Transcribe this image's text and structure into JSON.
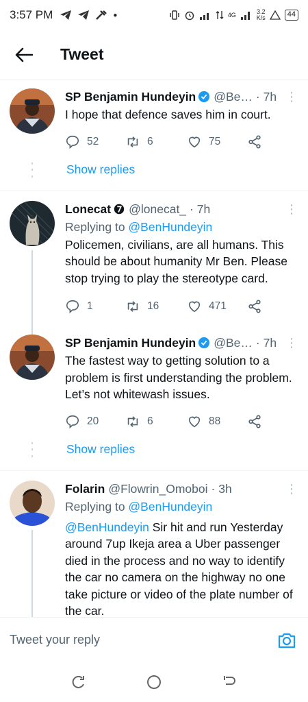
{
  "status_bar": {
    "time": "3:57 PM",
    "network": "4G",
    "speed": "3.2",
    "speed_unit": "K/s",
    "battery": "44"
  },
  "header": {
    "title": "Tweet"
  },
  "tweets": [
    {
      "name": "SP Benjamin Hundeyin",
      "verified": true,
      "handle": "@Be…",
      "time": "· 7h",
      "text": "I hope that defence saves him in court.",
      "replies": "52",
      "retweets": "6",
      "likes": "75",
      "show_replies": "Show replies"
    },
    {
      "name": "Lonecat",
      "handle": "@lonecat_",
      "time": "· 7h",
      "replying_prefix": "Replying to ",
      "replying_to": "@BenHundeyin",
      "text": "Policemen, civilians, are all humans. This should be about humanity Mr Ben. Please stop trying to play the stereotype card.",
      "replies": "1",
      "retweets": "16",
      "likes": "471"
    },
    {
      "name": "SP Benjamin Hundeyin",
      "verified": true,
      "handle": "@Be…",
      "time": "· 7h",
      "text": "The fastest way to getting solution to a problem is first understanding the problem. Let’s not whitewash issues.",
      "replies": "20",
      "retweets": "6",
      "likes": "88",
      "show_replies": "Show replies"
    },
    {
      "name": "Folarin",
      "handle": "@Flowrin_Omoboi",
      "time": "· 3h",
      "replying_prefix": "Replying to ",
      "replying_to": "@BenHundeyin",
      "mention": "@BenHundeyin",
      "text": " Sir hit and run Yesterday around 7up Ikeja area a Uber passenger died in the process and no way to identify the car no camera on the highway no one take picture or video of the plate number of the car."
    }
  ],
  "reply_bar": {
    "placeholder": "Tweet your reply"
  },
  "colors": {
    "accent": "#1d9bf0",
    "text": "#0f1419",
    "muted": "#536471",
    "divider": "#eff3f4",
    "thread_line": "#cfd9de"
  },
  "icons": {
    "back": "arrow-left-icon",
    "verified": "verified-badge-icon",
    "reply": "comment-icon",
    "retweet": "retweet-icon",
    "like": "heart-icon",
    "share": "share-icon",
    "more": "more-vertical-icon",
    "camera": "camera-icon"
  }
}
